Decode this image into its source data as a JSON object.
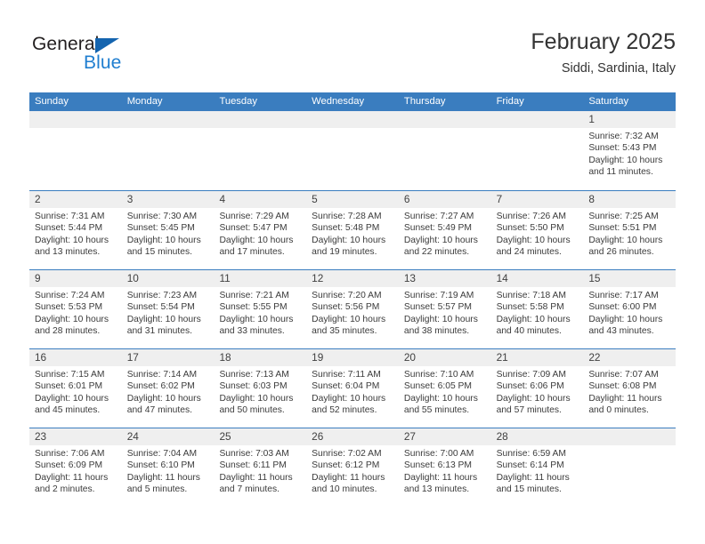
{
  "brand": {
    "name_top": "General",
    "name_bottom": "Blue",
    "triangle_color": "#1464af",
    "blue_color": "#1f7ed0"
  },
  "header": {
    "title": "February 2025",
    "subtitle": "Siddi, Sardinia, Italy"
  },
  "theme": {
    "header_bar": "#3a7dbf",
    "day_band": "#efefef",
    "text": "#3b3b3b"
  },
  "weekdays": [
    "Sunday",
    "Monday",
    "Tuesday",
    "Wednesday",
    "Thursday",
    "Friday",
    "Saturday"
  ],
  "labels": {
    "sunrise": "Sunrise:",
    "sunset": "Sunset:",
    "daylight": "Daylight:"
  },
  "weeks": [
    [
      {
        "day": "",
        "empty": true
      },
      {
        "day": "",
        "empty": true
      },
      {
        "day": "",
        "empty": true
      },
      {
        "day": "",
        "empty": true
      },
      {
        "day": "",
        "empty": true
      },
      {
        "day": "",
        "empty": true
      },
      {
        "day": "1",
        "sunrise": "Sunrise: 7:32 AM",
        "sunset": "Sunset: 5:43 PM",
        "daylight": "Daylight: 10 hours and 11 minutes."
      }
    ],
    [
      {
        "day": "2",
        "sunrise": "Sunrise: 7:31 AM",
        "sunset": "Sunset: 5:44 PM",
        "daylight": "Daylight: 10 hours and 13 minutes."
      },
      {
        "day": "3",
        "sunrise": "Sunrise: 7:30 AM",
        "sunset": "Sunset: 5:45 PM",
        "daylight": "Daylight: 10 hours and 15 minutes."
      },
      {
        "day": "4",
        "sunrise": "Sunrise: 7:29 AM",
        "sunset": "Sunset: 5:47 PM",
        "daylight": "Daylight: 10 hours and 17 minutes."
      },
      {
        "day": "5",
        "sunrise": "Sunrise: 7:28 AM",
        "sunset": "Sunset: 5:48 PM",
        "daylight": "Daylight: 10 hours and 19 minutes."
      },
      {
        "day": "6",
        "sunrise": "Sunrise: 7:27 AM",
        "sunset": "Sunset: 5:49 PM",
        "daylight": "Daylight: 10 hours and 22 minutes."
      },
      {
        "day": "7",
        "sunrise": "Sunrise: 7:26 AM",
        "sunset": "Sunset: 5:50 PM",
        "daylight": "Daylight: 10 hours and 24 minutes."
      },
      {
        "day": "8",
        "sunrise": "Sunrise: 7:25 AM",
        "sunset": "Sunset: 5:51 PM",
        "daylight": "Daylight: 10 hours and 26 minutes."
      }
    ],
    [
      {
        "day": "9",
        "sunrise": "Sunrise: 7:24 AM",
        "sunset": "Sunset: 5:53 PM",
        "daylight": "Daylight: 10 hours and 28 minutes."
      },
      {
        "day": "10",
        "sunrise": "Sunrise: 7:23 AM",
        "sunset": "Sunset: 5:54 PM",
        "daylight": "Daylight: 10 hours and 31 minutes."
      },
      {
        "day": "11",
        "sunrise": "Sunrise: 7:21 AM",
        "sunset": "Sunset: 5:55 PM",
        "daylight": "Daylight: 10 hours and 33 minutes."
      },
      {
        "day": "12",
        "sunrise": "Sunrise: 7:20 AM",
        "sunset": "Sunset: 5:56 PM",
        "daylight": "Daylight: 10 hours and 35 minutes."
      },
      {
        "day": "13",
        "sunrise": "Sunrise: 7:19 AM",
        "sunset": "Sunset: 5:57 PM",
        "daylight": "Daylight: 10 hours and 38 minutes."
      },
      {
        "day": "14",
        "sunrise": "Sunrise: 7:18 AM",
        "sunset": "Sunset: 5:58 PM",
        "daylight": "Daylight: 10 hours and 40 minutes."
      },
      {
        "day": "15",
        "sunrise": "Sunrise: 7:17 AM",
        "sunset": "Sunset: 6:00 PM",
        "daylight": "Daylight: 10 hours and 43 minutes."
      }
    ],
    [
      {
        "day": "16",
        "sunrise": "Sunrise: 7:15 AM",
        "sunset": "Sunset: 6:01 PM",
        "daylight": "Daylight: 10 hours and 45 minutes."
      },
      {
        "day": "17",
        "sunrise": "Sunrise: 7:14 AM",
        "sunset": "Sunset: 6:02 PM",
        "daylight": "Daylight: 10 hours and 47 minutes."
      },
      {
        "day": "18",
        "sunrise": "Sunrise: 7:13 AM",
        "sunset": "Sunset: 6:03 PM",
        "daylight": "Daylight: 10 hours and 50 minutes."
      },
      {
        "day": "19",
        "sunrise": "Sunrise: 7:11 AM",
        "sunset": "Sunset: 6:04 PM",
        "daylight": "Daylight: 10 hours and 52 minutes."
      },
      {
        "day": "20",
        "sunrise": "Sunrise: 7:10 AM",
        "sunset": "Sunset: 6:05 PM",
        "daylight": "Daylight: 10 hours and 55 minutes."
      },
      {
        "day": "21",
        "sunrise": "Sunrise: 7:09 AM",
        "sunset": "Sunset: 6:06 PM",
        "daylight": "Daylight: 10 hours and 57 minutes."
      },
      {
        "day": "22",
        "sunrise": "Sunrise: 7:07 AM",
        "sunset": "Sunset: 6:08 PM",
        "daylight": "Daylight: 11 hours and 0 minutes."
      }
    ],
    [
      {
        "day": "23",
        "sunrise": "Sunrise: 7:06 AM",
        "sunset": "Sunset: 6:09 PM",
        "daylight": "Daylight: 11 hours and 2 minutes."
      },
      {
        "day": "24",
        "sunrise": "Sunrise: 7:04 AM",
        "sunset": "Sunset: 6:10 PM",
        "daylight": "Daylight: 11 hours and 5 minutes."
      },
      {
        "day": "25",
        "sunrise": "Sunrise: 7:03 AM",
        "sunset": "Sunset: 6:11 PM",
        "daylight": "Daylight: 11 hours and 7 minutes."
      },
      {
        "day": "26",
        "sunrise": "Sunrise: 7:02 AM",
        "sunset": "Sunset: 6:12 PM",
        "daylight": "Daylight: 11 hours and 10 minutes."
      },
      {
        "day": "27",
        "sunrise": "Sunrise: 7:00 AM",
        "sunset": "Sunset: 6:13 PM",
        "daylight": "Daylight: 11 hours and 13 minutes."
      },
      {
        "day": "28",
        "sunrise": "Sunrise: 6:59 AM",
        "sunset": "Sunset: 6:14 PM",
        "daylight": "Daylight: 11 hours and 15 minutes."
      },
      {
        "day": "",
        "empty": true
      }
    ]
  ]
}
